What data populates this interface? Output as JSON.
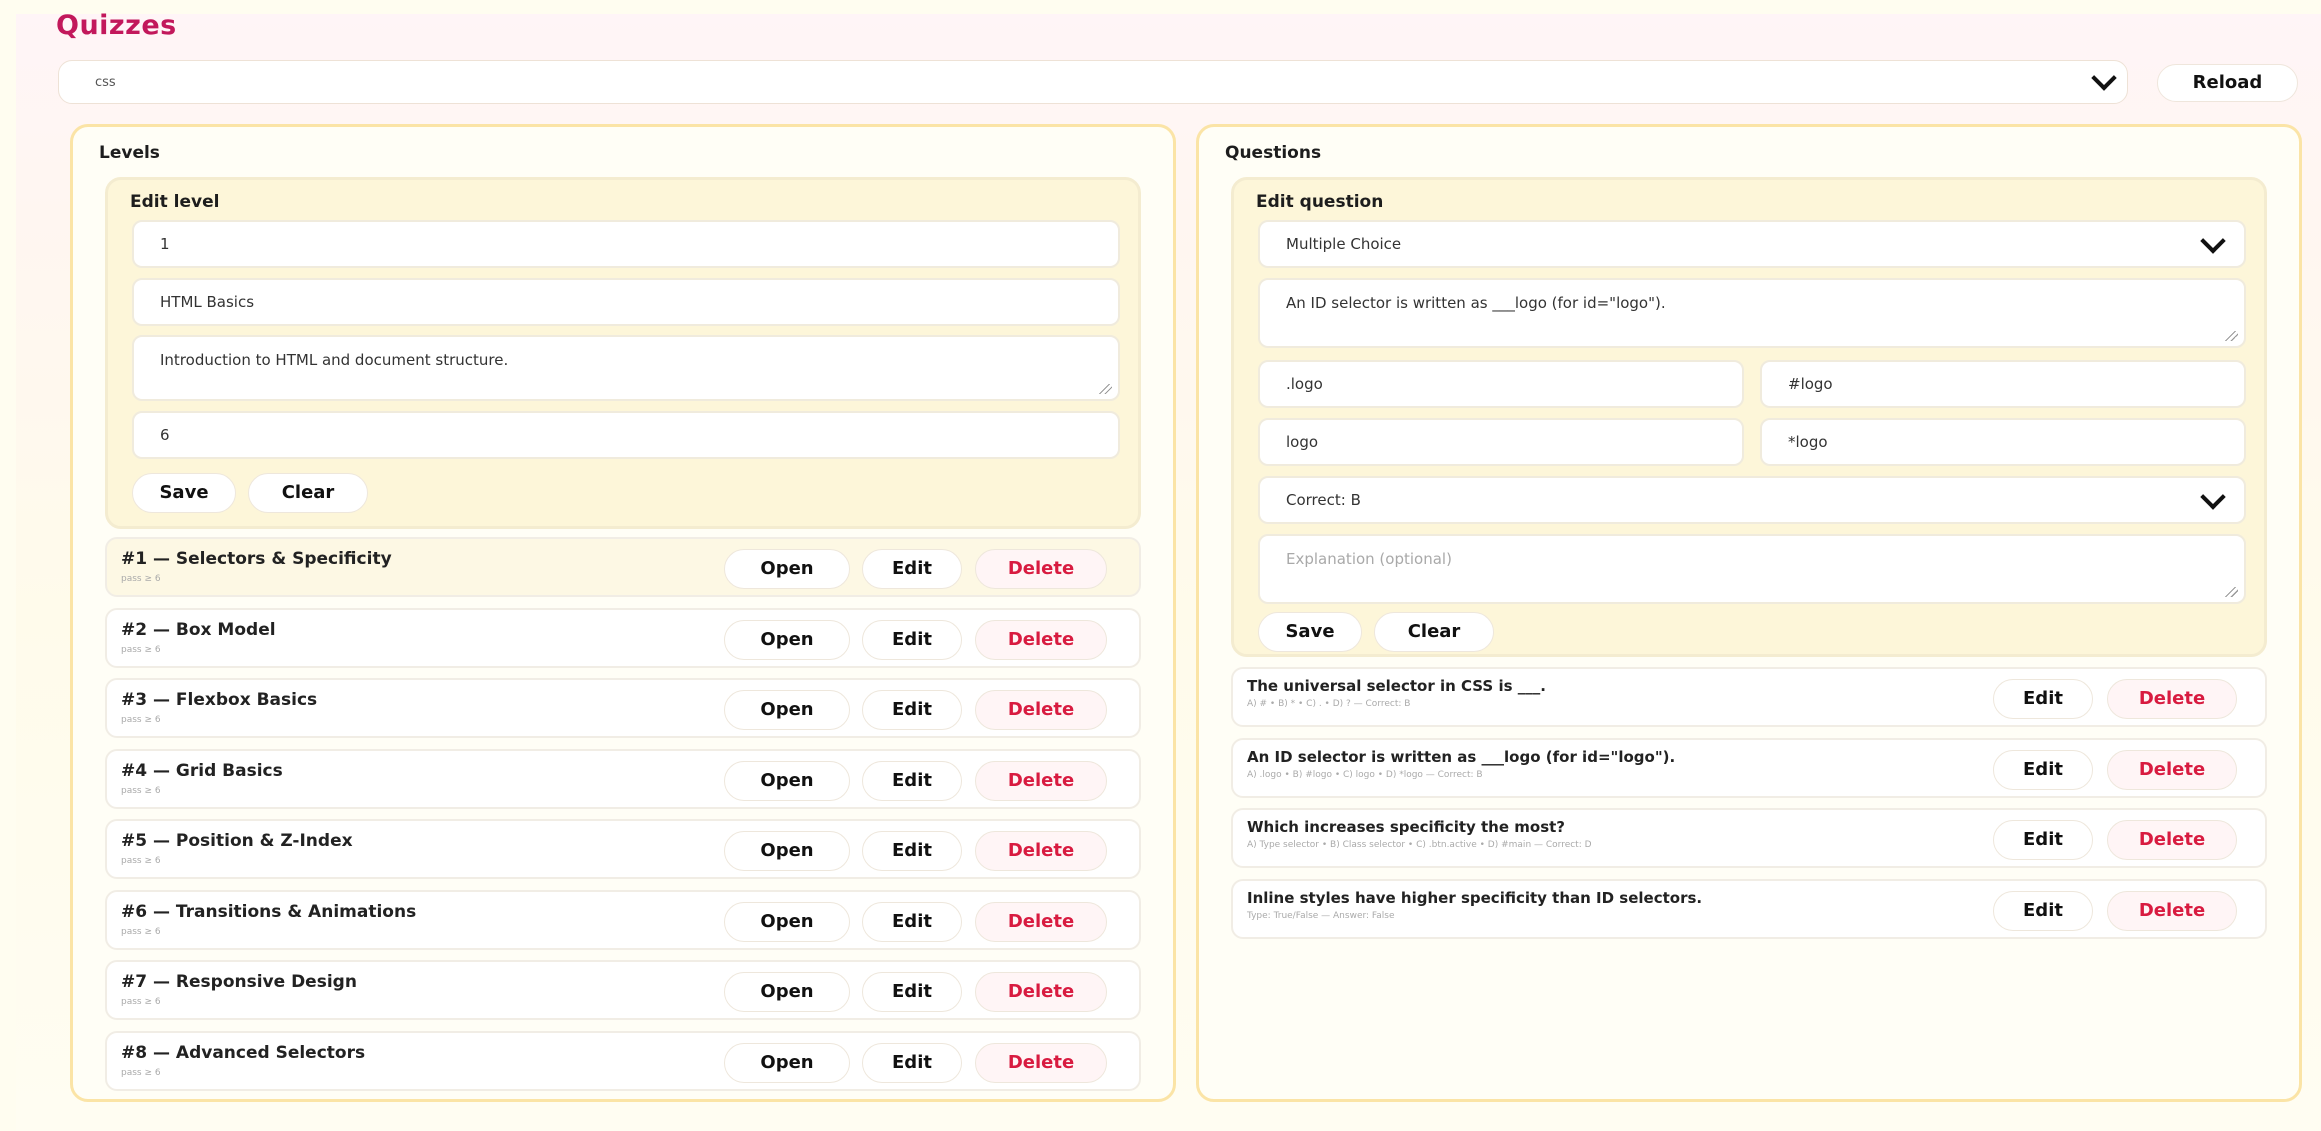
{
  "header": {
    "title": "Quizzes",
    "reload_label": "Reload"
  },
  "quiz_select": {
    "value": "css"
  },
  "levels": {
    "title": "Levels",
    "edit": {
      "heading": "Edit level",
      "number_value": "1",
      "name_value": "HTML Basics",
      "description_value": "Introduction to HTML and document structure.",
      "pass_value": "6",
      "save_label": "Save",
      "clear_label": "Clear"
    },
    "open_label": "Open",
    "edit_label": "Edit",
    "delete_label": "Delete",
    "items": [
      {
        "title": "#1 — Selectors & Specificity",
        "sub": "pass ≥ 6"
      },
      {
        "title": "#2 — Box Model",
        "sub": "pass ≥ 6"
      },
      {
        "title": "#3 — Flexbox Basics",
        "sub": "pass ≥ 6"
      },
      {
        "title": "#4 — Grid Basics",
        "sub": "pass ≥ 6"
      },
      {
        "title": "#5 — Position & Z-Index",
        "sub": "pass ≥ 6"
      },
      {
        "title": "#6 — Transitions & Animations",
        "sub": "pass ≥ 6"
      },
      {
        "title": "#7 — Responsive Design",
        "sub": "pass ≥ 6"
      },
      {
        "title": "#8 — Advanced Selectors",
        "sub": "pass ≥ 6"
      }
    ]
  },
  "questions": {
    "title": "Questions",
    "edit": {
      "heading": "Edit question",
      "type_value": "Multiple Choice",
      "prompt_value": "An ID selector is written as ___logo (for id=\"logo\").",
      "option_a": ".logo",
      "option_b": "#logo",
      "option_c": "logo",
      "option_d": "*logo",
      "correct_value": "Correct: B",
      "explanation_placeholder": "Explanation (optional)",
      "save_label": "Save",
      "clear_label": "Clear"
    },
    "edit_label": "Edit",
    "delete_label": "Delete",
    "items": [
      {
        "title": "The universal selector in CSS is ___.",
        "sub": "A) # • B) * • C) . • D) ? — Correct: B"
      },
      {
        "title": "An ID selector is written as ___logo (for id=\"logo\").",
        "sub": "A) .logo • B) #logo • C) logo • D) *logo — Correct: B"
      },
      {
        "title": "Which increases specificity the most?",
        "sub": "A) Type selector • B) Class selector • C) .btn.active • D) #main — Correct: D"
      },
      {
        "title": "Inline styles have higher specificity than ID selectors.",
        "sub": "Type: True/False — Answer: False"
      }
    ]
  },
  "colors": {
    "accent": "#c2185b",
    "delete": "#d81b40",
    "panel_border": "#fbe4a6"
  }
}
